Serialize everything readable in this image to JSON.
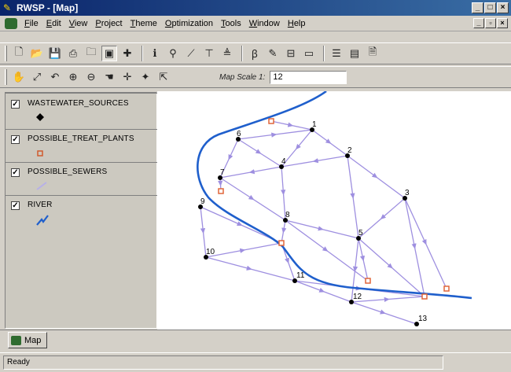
{
  "window": {
    "title": "RWSP - [Map]"
  },
  "menu": [
    "File",
    "Edit",
    "View",
    "Project",
    "Theme",
    "Optimization",
    "Tools",
    "Window",
    "Help"
  ],
  "toolbar": {
    "map_scale_label": "Map Scale 1:",
    "map_scale_value": "12"
  },
  "layers": [
    {
      "name": "WASTEWATER_SOURCES",
      "checked": "✓"
    },
    {
      "name": "POSSIBLE_TREAT_PLANTS",
      "checked": "✓"
    },
    {
      "name": "POSSIBLE_SEWERS",
      "checked": "✓"
    },
    {
      "name": "RIVER",
      "checked": "✓"
    }
  ],
  "map": {
    "node_labels": [
      "1",
      "2",
      "3",
      "4",
      "5",
      "6",
      "7",
      "8",
      "9",
      "10",
      "11",
      "12",
      "13"
    ],
    "colors": {
      "sewer": "#9e8fe0",
      "river": "#1f5fcc",
      "plant": "#e0663a"
    }
  },
  "tabs": {
    "map_tab": "Map"
  },
  "status": {
    "text": "Ready"
  }
}
